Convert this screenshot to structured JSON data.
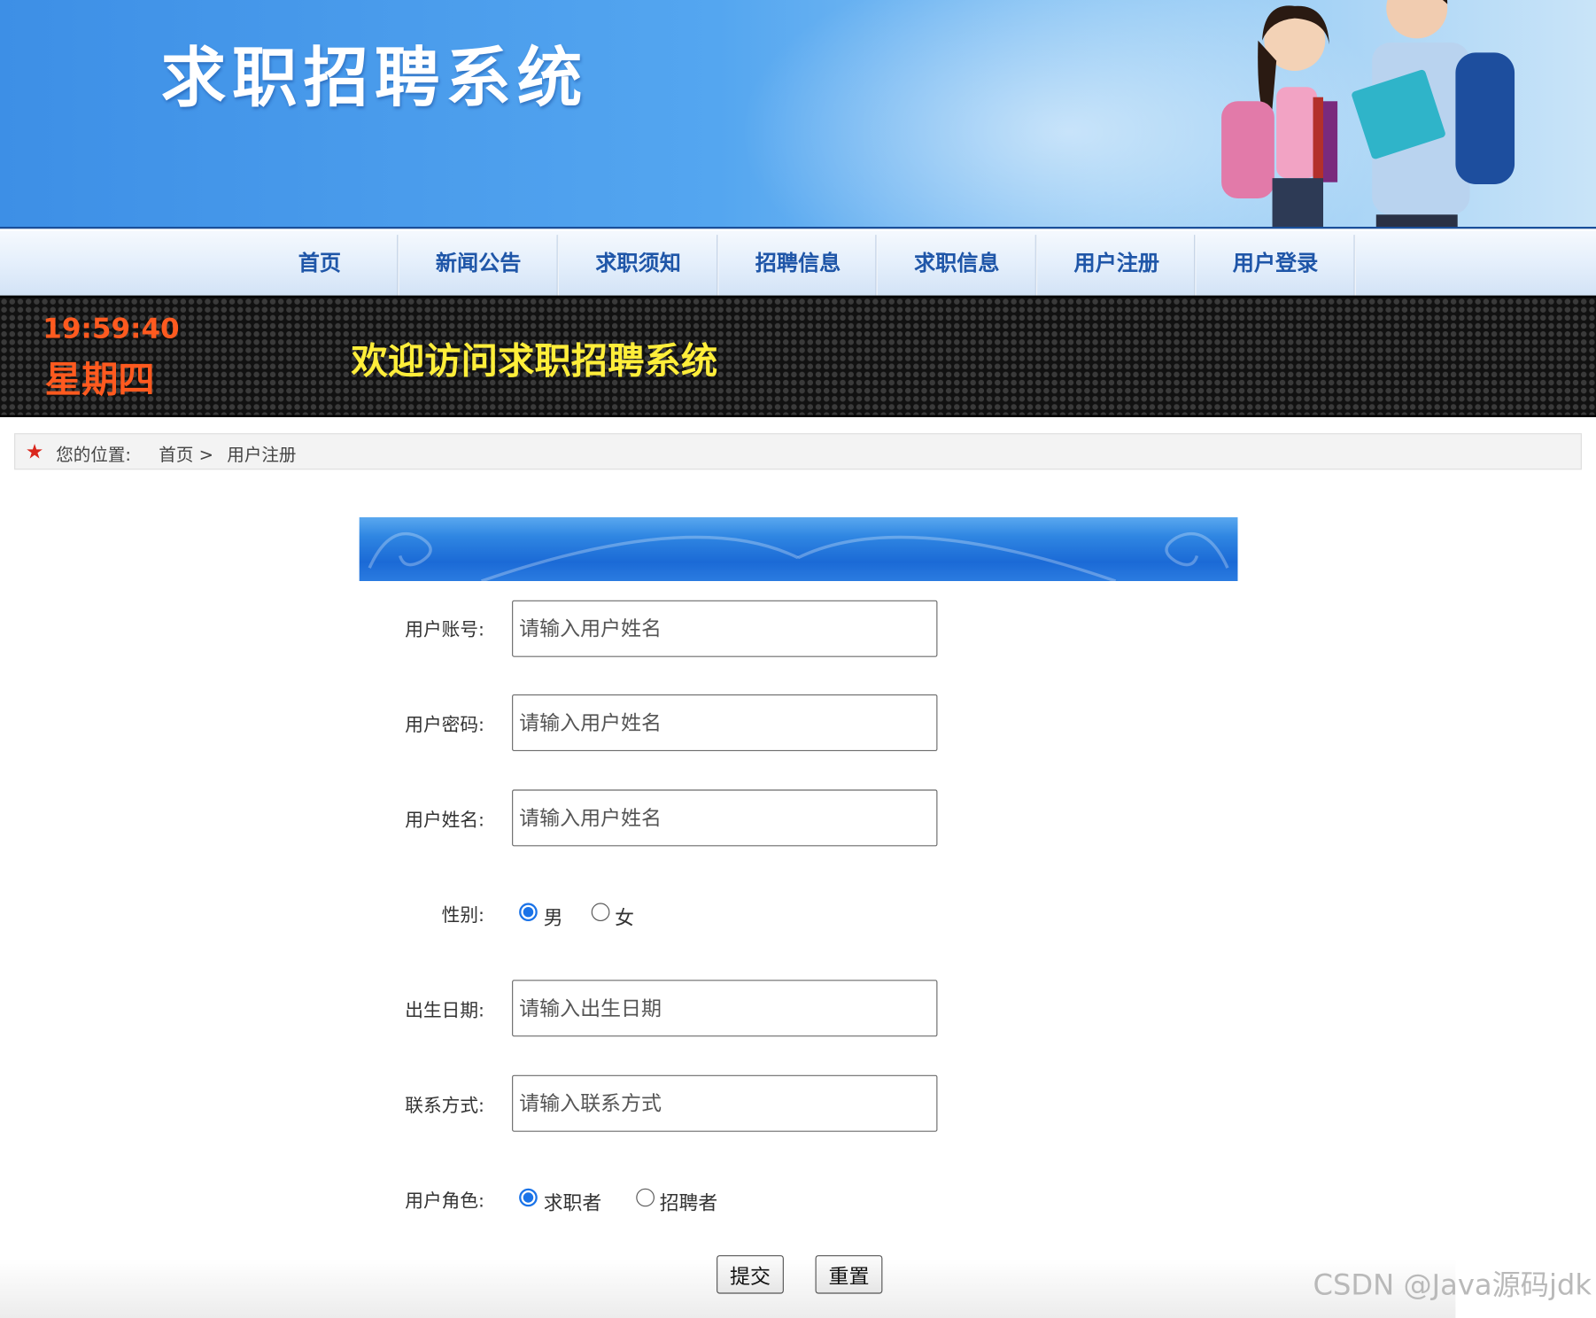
{
  "header": {
    "site_title": "求职招聘系统"
  },
  "nav": {
    "items": [
      {
        "label": "首页"
      },
      {
        "label": "新闻公告"
      },
      {
        "label": "求职须知"
      },
      {
        "label": "招聘信息"
      },
      {
        "label": "求职信息"
      },
      {
        "label": "用户注册"
      },
      {
        "label": "用户登录"
      }
    ]
  },
  "ticker": {
    "time": "19:59:40",
    "weekday": "星期四",
    "message": "欢迎访问求职招聘系统"
  },
  "breadcrumb": {
    "prefix": "您的位置:",
    "home": "首页 >",
    "current": "用户注册"
  },
  "form": {
    "account": {
      "label": "用户账号:",
      "placeholder": "请输入用户姓名"
    },
    "password": {
      "label": "用户密码:",
      "placeholder": "请输入用户姓名"
    },
    "name": {
      "label": "用户姓名:",
      "placeholder": "请输入用户姓名"
    },
    "gender": {
      "label": "性别:",
      "options": [
        {
          "label": "男",
          "checked": true
        },
        {
          "label": "女",
          "checked": false
        }
      ]
    },
    "birthdate": {
      "label": "出生日期:",
      "placeholder": "请输入出生日期"
    },
    "contact": {
      "label": "联系方式:",
      "placeholder": "请输入联系方式"
    },
    "role": {
      "label": "用户角色:",
      "options": [
        {
          "label": "求职者",
          "checked": true
        },
        {
          "label": "招聘者",
          "checked": false
        }
      ]
    },
    "submit_label": "提交",
    "reset_label": "重置"
  },
  "watermark": "CSDN @Java源码jdk",
  "colors": {
    "nav_text": "#1f56a8",
    "clock": "#ff5a1f",
    "ticker_text": "#ffee3a",
    "radio_checked": "#1a73e8"
  }
}
